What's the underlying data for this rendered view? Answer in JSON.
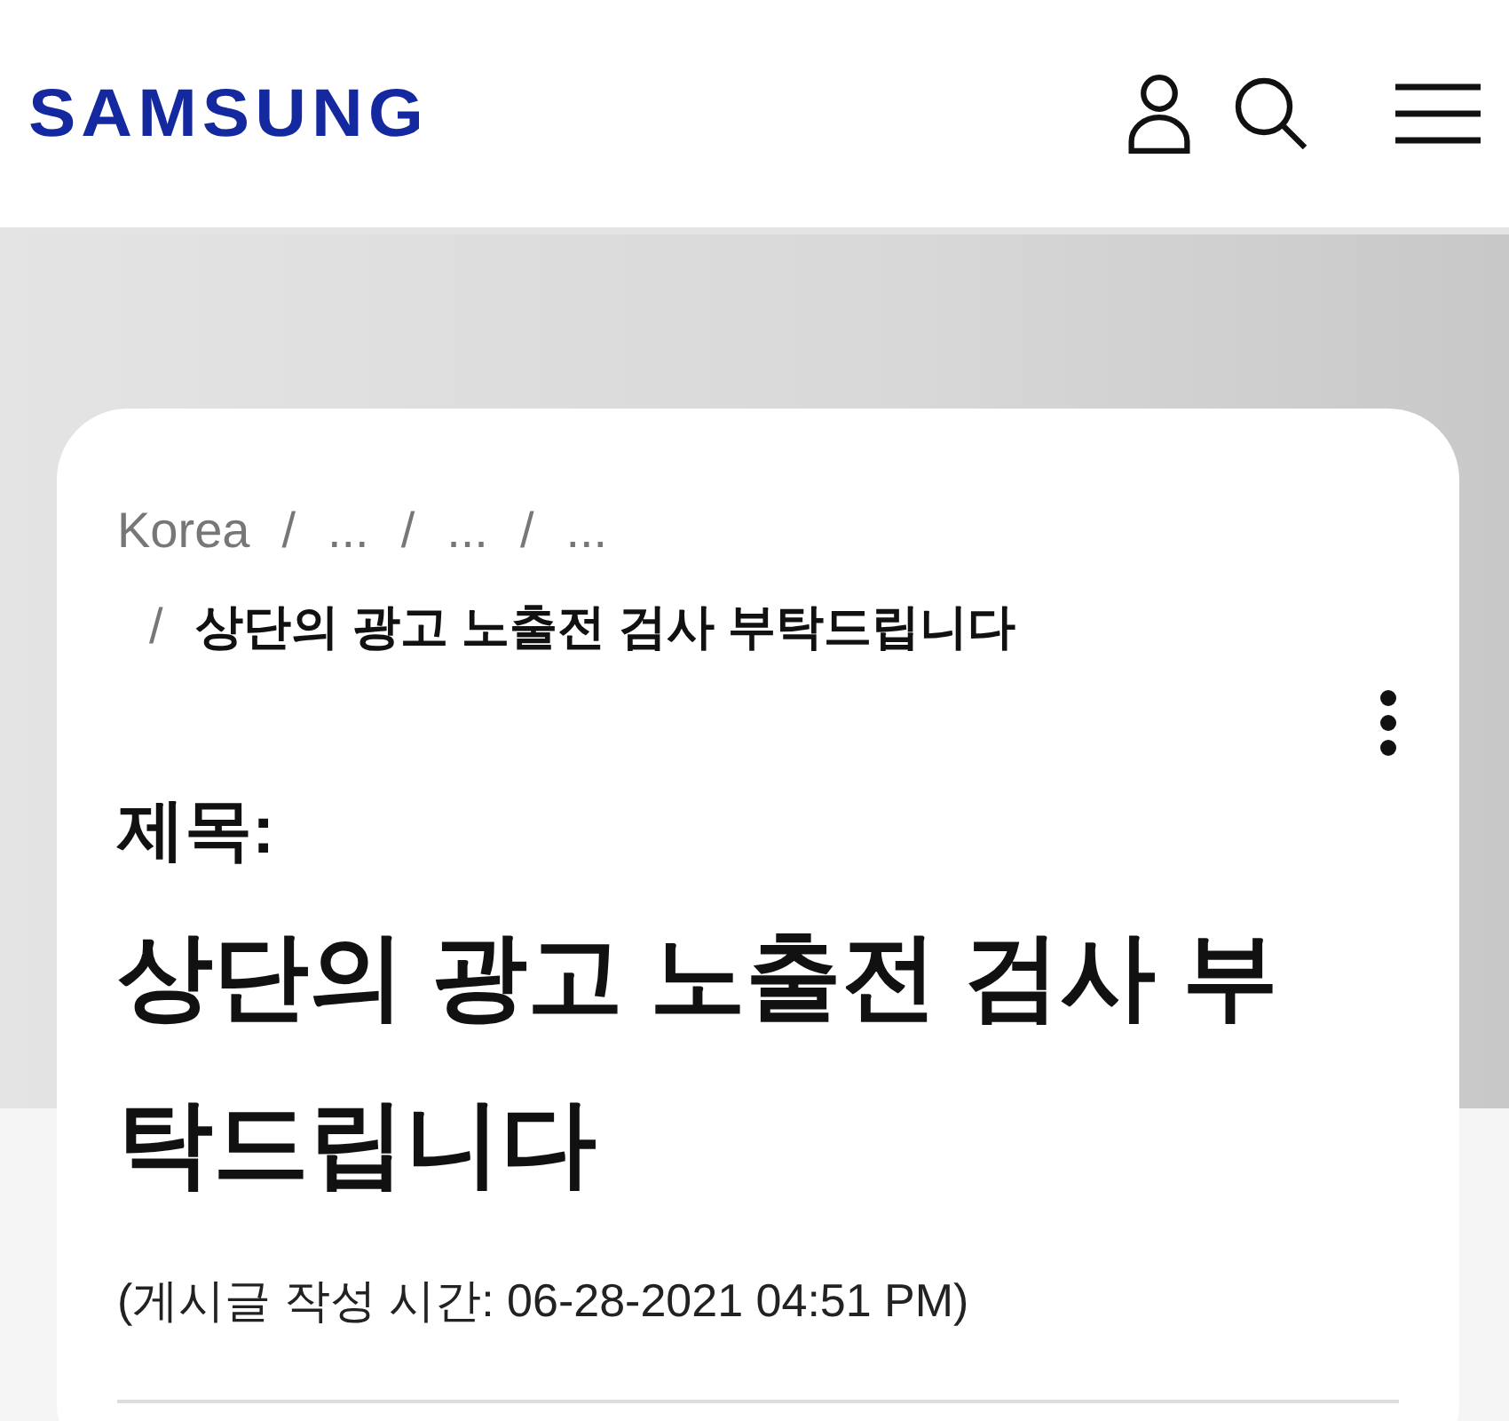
{
  "header": {
    "logo": "SAMSUNG"
  },
  "breadcrumb": [
    {
      "label": "Korea",
      "current": false
    },
    {
      "separator": "/",
      "label": "...",
      "current": false
    },
    {
      "separator": "/",
      "label": "...",
      "current": false
    },
    {
      "separator": "/",
      "label": "...",
      "current": false
    },
    {
      "separator": "/",
      "label": "상단의 광고 노출전 검사 부탁드립니다",
      "current": true
    }
  ],
  "post": {
    "subject_label": "제목:",
    "title": "상단의 광고 노출전 검사 부탁드립니다",
    "posted": "(게시글 작성 시간: 06-28-2021 04:51 PM)"
  }
}
